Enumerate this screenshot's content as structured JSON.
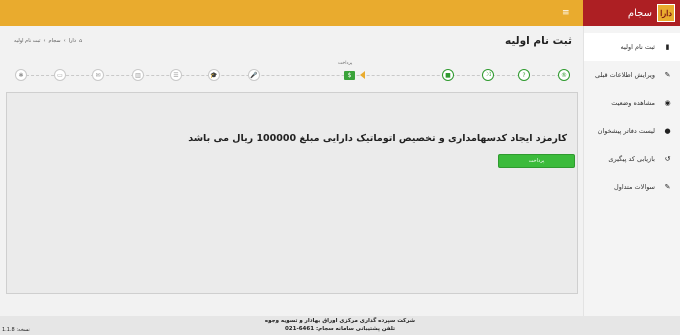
{
  "brand": {
    "name": "سجام",
    "logo_text": "دارا",
    "icon": "dara-logo-icon"
  },
  "header": {
    "menu_icon": "hamburger-icon"
  },
  "sidebar": {
    "items": [
      {
        "label": "ثبت نام اولیه",
        "icon": "book-icon"
      },
      {
        "label": "ویرایش اطلاعات قبلی",
        "icon": "edit-icon"
      },
      {
        "label": "مشاهده وضعیت",
        "icon": "eye-icon"
      },
      {
        "label": "لیست دفاتر پیشخوان",
        "icon": "user-icon"
      },
      {
        "label": "بازیابی کد پیگیری",
        "icon": "undo-icon"
      },
      {
        "label": "سوالات متداول",
        "icon": "edit-icon"
      }
    ]
  },
  "page": {
    "title": "ثبت نام اولیه"
  },
  "breadcrumb": [
    "دارا",
    "سجام",
    "ثبت نام اولیه"
  ],
  "steps": {
    "current_label": "پرداخت",
    "icons": [
      "®",
      "?",
      "⤨",
      "■",
      "$",
      "🎤",
      "🎓",
      "☰",
      "▥",
      "✉",
      "▭",
      "✱"
    ]
  },
  "panel": {
    "message": "کارمزد ایجاد کدسهامداری و تخصیص اتوماتیک دارایی مبلغ 100000 ریال می باشد",
    "button_label": "پرداخت"
  },
  "footer": {
    "line1": "شرکت سپرده گذاری مرکزی اوراق بهادار و تسویه وجوه",
    "line2": "تلفن پشتیبانی سامانه سجام: 6461-021",
    "version": "نسخه: 1.1.8"
  }
}
